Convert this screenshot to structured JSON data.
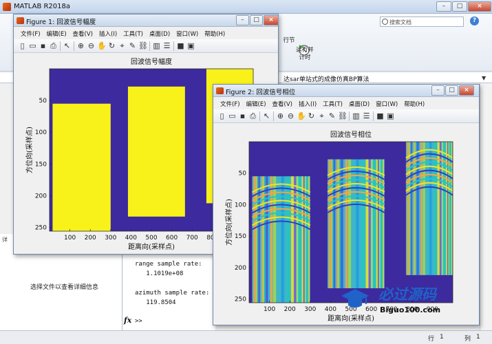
{
  "main_window": {
    "title": "MATLAB R2018a",
    "search_placeholder": "搜索文档",
    "help_icon_text": "?",
    "ribbon_run_section": "行节",
    "ribbon_run_advance": "运行并\n计时",
    "path_text": "达sar单站式的成像仿真BP算法",
    "left_pane_detail_label": "详",
    "left_pane_message": "选择文件以查看详细信息",
    "command_window": {
      "lines": [
        "range sample rate:",
        "   1.1019e+08",
        "",
        "azimuth sample rate:",
        "   119.8504"
      ],
      "prompt_symbol": "fx",
      "prompt": ">>"
    },
    "status_row_label": "行",
    "status_row_value": "1",
    "status_col_label": "列",
    "status_col_value": "1"
  },
  "figure1": {
    "title": "Figure 1: 回波信号幅度",
    "menus": [
      "文件(F)",
      "编辑(E)",
      "查看(V)",
      "插入(I)",
      "工具(T)",
      "桌面(D)",
      "窗口(W)",
      "帮助(H)"
    ],
    "toolbar_icons": [
      "new-icon",
      "open-icon",
      "save-icon",
      "print-icon",
      "pointer-icon",
      "zoom-in-icon",
      "zoom-out-icon",
      "pan-icon",
      "rotate-icon",
      "data-cursor-icon",
      "brush-icon",
      "link-icon",
      "colorbar-icon",
      "legend-icon",
      "hide-plot-tools-icon",
      "show-plot-tools-icon"
    ]
  },
  "figure2": {
    "title": "Figure 2: 回波信号相位",
    "menus": [
      "文件(F)",
      "编辑(E)",
      "查看(V)",
      "插入(I)",
      "工具(T)",
      "桌面(D)",
      "窗口(W)",
      "帮助(H)"
    ]
  },
  "chart_data": [
    {
      "type": "heatmap",
      "title": "回波信号幅度",
      "xlabel": "距离向(采样点)",
      "ylabel": "方位向(采样点)",
      "xticks": [
        100,
        200,
        300,
        400,
        500,
        600,
        700,
        800
      ],
      "yticks": [
        50,
        100,
        150,
        200,
        250
      ],
      "xlim": [
        0,
        1000
      ],
      "ylim": [
        0,
        256
      ],
      "background_color": "#3d2a9e",
      "foreground_color": "#f9f11a",
      "regions": [
        {
          "x": [
            15,
            300
          ],
          "y": [
            55,
            256
          ]
        },
        {
          "x": [
            385,
            665
          ],
          "y": [
            28,
            233
          ]
        },
        {
          "x": [
            770,
            1000
          ],
          "y": [
            0,
            212
          ]
        }
      ]
    },
    {
      "type": "heatmap",
      "title": "回波信号相位",
      "xlabel": "距离向(采样点)",
      "ylabel": "方位向(采样点)",
      "xticks": [
        100,
        200,
        300,
        400,
        500,
        600,
        700,
        800,
        900
      ],
      "yticks": [
        50,
        100,
        150,
        200,
        250
      ],
      "xlim": [
        0,
        1000
      ],
      "ylim": [
        0,
        256
      ],
      "background_color": "#3d2a9e",
      "regions": [
        {
          "x": [
            15,
            300
          ],
          "y": [
            55,
            256
          ]
        },
        {
          "x": [
            385,
            665
          ],
          "y": [
            28,
            233
          ]
        },
        {
          "x": [
            770,
            1000
          ],
          "y": [
            0,
            212
          ]
        }
      ]
    }
  ],
  "watermark": {
    "text": "必过源码",
    "url": "Biguo100.com"
  }
}
